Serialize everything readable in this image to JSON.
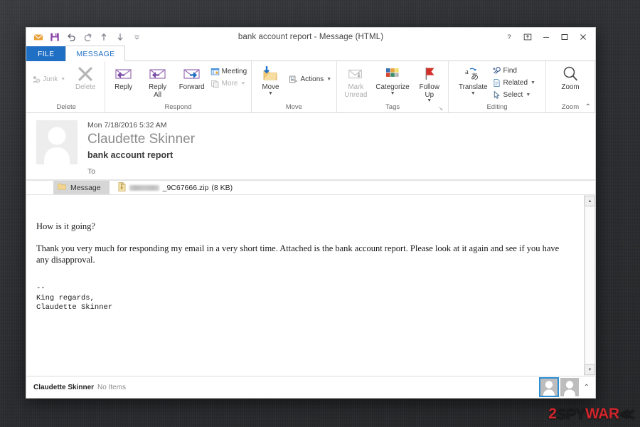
{
  "window": {
    "title": "bank account report - Message (HTML)",
    "quick_access": [
      {
        "name": "mail-icon",
        "label": "Mail"
      },
      {
        "name": "save-icon",
        "label": "Save"
      },
      {
        "name": "undo-icon",
        "label": "Undo"
      },
      {
        "name": "redo-icon",
        "label": "Redo"
      },
      {
        "name": "previous-item-icon",
        "label": "Previous Item"
      },
      {
        "name": "next-item-icon",
        "label": "Next Item"
      },
      {
        "name": "customize-quick-access-icon",
        "label": "Customize Quick Access Toolbar"
      }
    ],
    "controls": [
      {
        "name": "help-button",
        "glyph": "?"
      },
      {
        "name": "ribbon-display-options-button",
        "glyph": "⌧"
      },
      {
        "name": "minimize-button",
        "glyph": "–"
      },
      {
        "name": "maximize-button",
        "glyph": "❐"
      },
      {
        "name": "close-button",
        "glyph": "✕"
      }
    ]
  },
  "tabs": {
    "file": "FILE",
    "message": "MESSAGE"
  },
  "ribbon": {
    "collapse_glyph": "⌃",
    "groups": [
      {
        "label": "Delete",
        "has_dialog_launcher": false,
        "small": [
          {
            "label": "Junk",
            "icon": "junk-icon",
            "caret": true,
            "disabled": true
          }
        ],
        "big": [
          {
            "label": "Delete",
            "label2": "",
            "icon": "delete-icon",
            "caret": false,
            "disabled": true
          }
        ]
      },
      {
        "label": "Respond",
        "has_dialog_launcher": false,
        "big": [
          {
            "label": "Reply",
            "label2": "",
            "icon": "reply-icon",
            "caret": false,
            "disabled": false
          },
          {
            "label": "Reply",
            "label2": "All",
            "icon": "reply-all-icon",
            "caret": false,
            "disabled": false
          },
          {
            "label": "Forward",
            "label2": "",
            "icon": "forward-icon",
            "caret": false,
            "disabled": false
          }
        ],
        "small": [
          {
            "label": "Meeting",
            "icon": "meeting-icon",
            "caret": false,
            "disabled": false
          },
          {
            "label": "More",
            "icon": "more-icon",
            "caret": true,
            "disabled": true
          }
        ]
      },
      {
        "label": "Move",
        "has_dialog_launcher": false,
        "big": [
          {
            "label": "Move",
            "label2": "",
            "icon": "move-folder-icon",
            "caret": true,
            "disabled": false
          }
        ],
        "small": [
          {
            "label": "Actions",
            "icon": "actions-icon",
            "caret": true,
            "disabled": false
          }
        ]
      },
      {
        "label": "Tags",
        "has_dialog_launcher": true,
        "dialog_glyph": "↘",
        "big": [
          {
            "label": "Mark",
            "label2": "Unread",
            "icon": "mark-unread-icon",
            "caret": false,
            "disabled": true
          },
          {
            "label": "Categorize",
            "label2": "",
            "icon": "categorize-icon",
            "caret": true,
            "disabled": false
          },
          {
            "label": "Follow",
            "label2": "Up",
            "icon": "follow-up-icon",
            "caret": true,
            "disabled": false
          }
        ]
      },
      {
        "label": "Editing",
        "has_dialog_launcher": false,
        "big": [
          {
            "label": "Translate",
            "label2": "",
            "icon": "translate-icon",
            "caret": true,
            "disabled": false
          }
        ],
        "small": [
          {
            "label": "Find",
            "icon": "find-icon",
            "caret": false,
            "disabled": false
          },
          {
            "label": "Related",
            "icon": "related-icon",
            "caret": true,
            "disabled": false
          },
          {
            "label": "Select",
            "icon": "select-icon",
            "caret": true,
            "disabled": false
          }
        ]
      },
      {
        "label": "Zoom",
        "has_dialog_launcher": false,
        "big": [
          {
            "label": "Zoom",
            "label2": "",
            "icon": "zoom-icon",
            "caret": false,
            "disabled": false
          }
        ]
      }
    ]
  },
  "message": {
    "date": "Mon 7/18/2016 5:32 AM",
    "sender": "Claudette Skinner",
    "subject": "bank account report",
    "to_label": "To",
    "to_value": "",
    "attachment_tab_label": "Message",
    "attachment": {
      "name_redacted": true,
      "name_suffix": "_9C67666.zip",
      "size": "(8 KB)"
    },
    "body": {
      "paragraph1": "How is it going?",
      "paragraph2": "Thank you very much for responding my email in a very short time. Attached is the bank account report. Please look at it again and see if you have any disapproval.",
      "signature": "--\nKing regards,\nClaudette Skinner"
    }
  },
  "statusbar": {
    "name": "Claudette Skinner",
    "items": "No Items",
    "caret_glyph": "⌃"
  },
  "watermark": {
    "part1": "2",
    "part2": "SPY",
    "part3": "WAR",
    "part4": "≪"
  },
  "colors": {
    "file_tab_blue": "#1f6fc4",
    "active_tab_text": "#1f6fc4",
    "selection_blue": "#2e8fd4",
    "watermark_red": "#d0252b"
  }
}
